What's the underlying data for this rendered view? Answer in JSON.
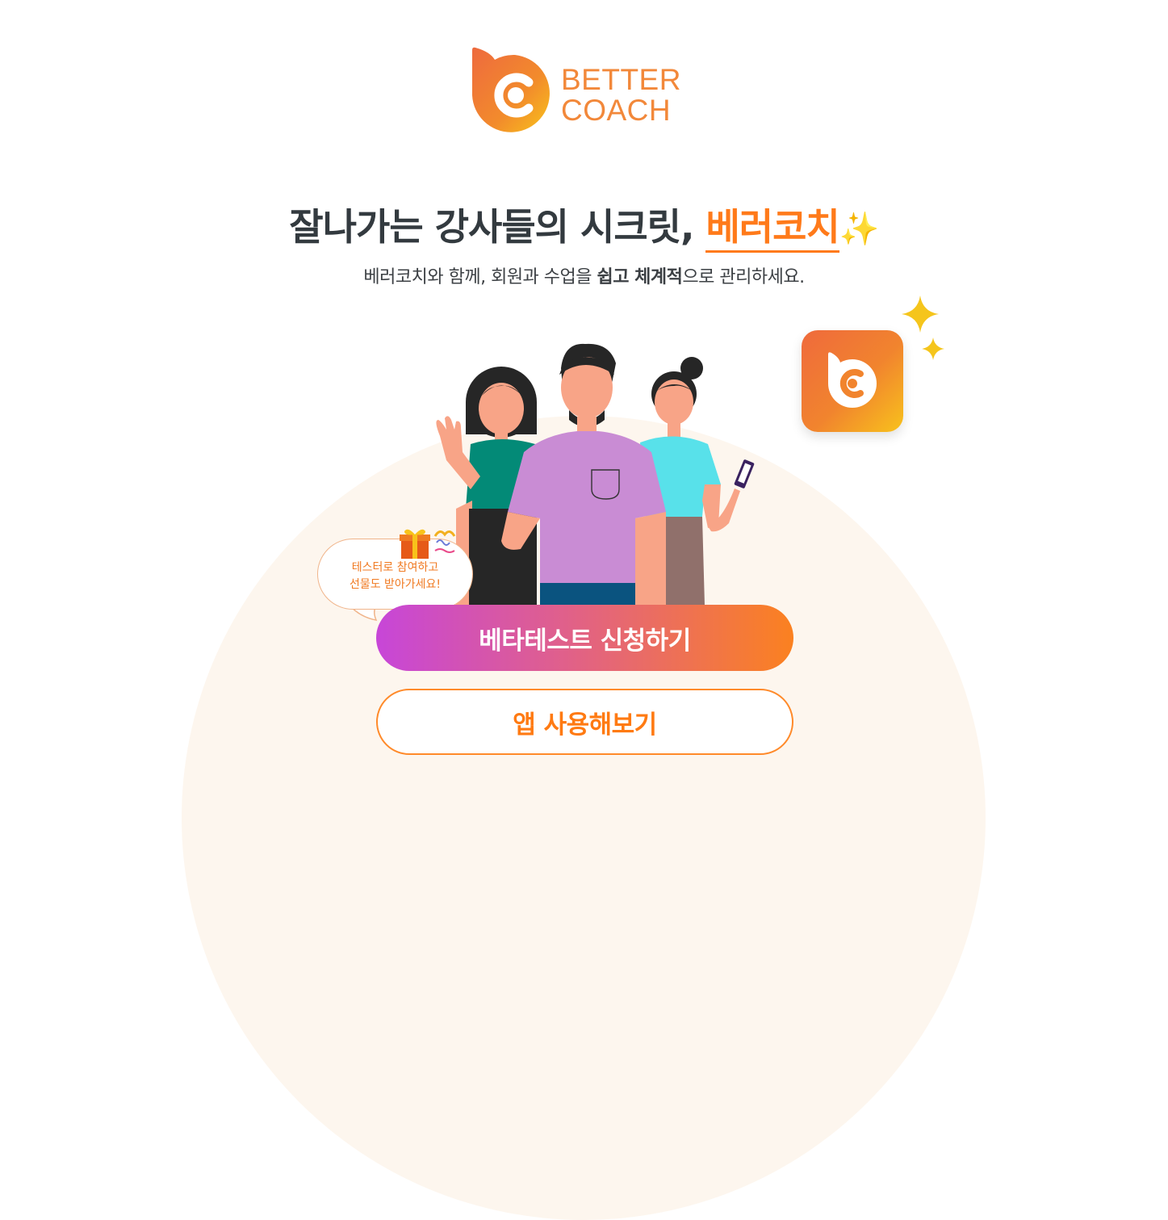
{
  "logo": {
    "line1": "BETTER",
    "line2": "COACH",
    "icon": "better-coach-logo-icon"
  },
  "headline": {
    "prefix": "잘나가는 강사들의 시크릿, ",
    "brand": "베러코치",
    "sparkle": "✨"
  },
  "subline": {
    "part1": "베러코치와 함께, 회원과 수업을 ",
    "bold1": "쉽고 체계적",
    "part2": "으로 관리하세요."
  },
  "app_icon": "better-coach-app-icon",
  "bubble": {
    "line1": "테스터로 참여하고",
    "line2": "선물도 받아가세요!"
  },
  "buttons": {
    "beta": "베타테스트 신청하기",
    "try_app": "앱 사용해보기"
  },
  "colors": {
    "brand_orange": "#ff7a1a",
    "gradient_start": "#c746d8",
    "gradient_end": "#fb8120",
    "background_arc": "#fdf6ee"
  }
}
